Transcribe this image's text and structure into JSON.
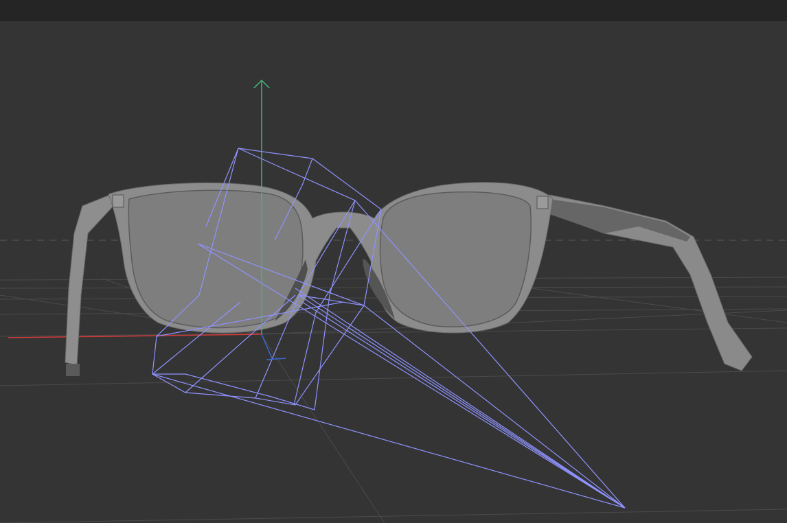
{
  "viewport": {
    "background": "#343434",
    "grid_color": "#4a4a4a",
    "horizon_color": "#5a5a5a"
  },
  "axes": {
    "x_color": "#d33a3a",
    "y_color": "#3fb878",
    "z_color": "#3a6ad3"
  },
  "model": {
    "icon": "eyeglasses-icon",
    "frame_color": "#8a8a8a",
    "lens_color": "#7f7f7f"
  },
  "cameras": {
    "icon": "camera-frustum-icon",
    "wire_color": "#8f93ff"
  }
}
